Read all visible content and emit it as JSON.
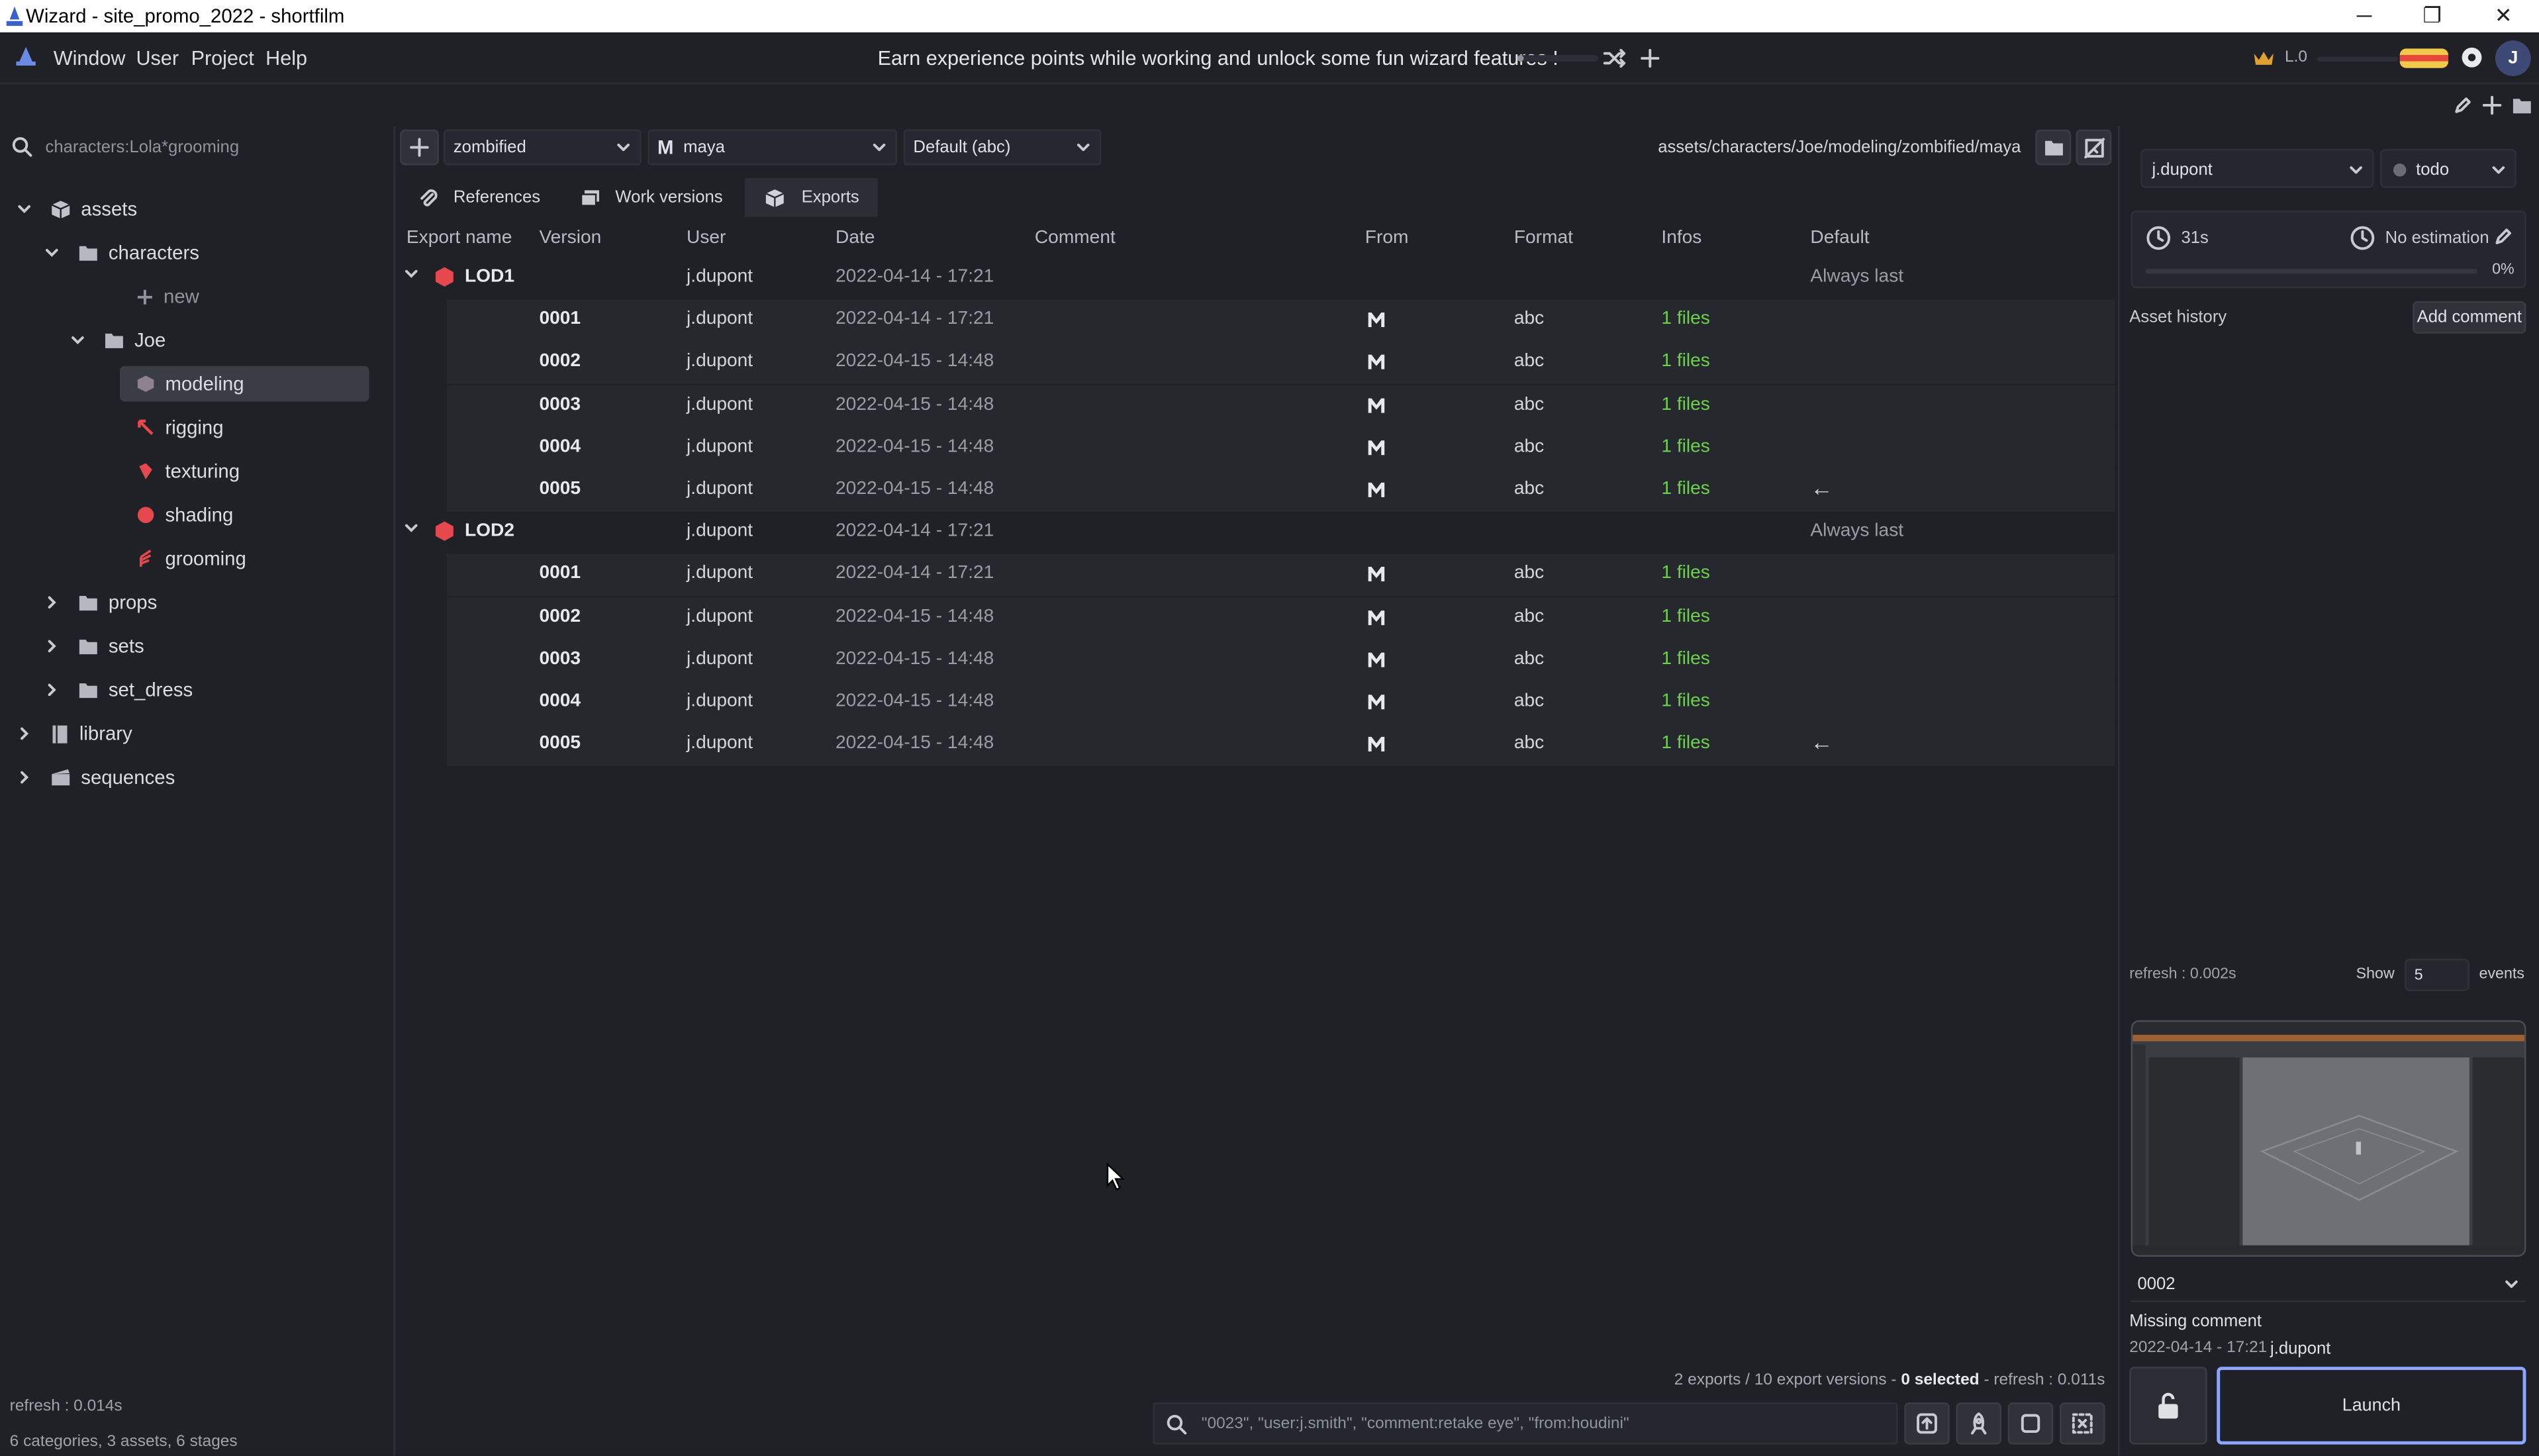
{
  "window": {
    "title": "Wizard - site_promo_2022 - shortfilm",
    "min": "─",
    "max": "❐",
    "close": "✕"
  },
  "menu": {
    "items": [
      "Window",
      "User",
      "Project",
      "Help"
    ]
  },
  "xp": {
    "message": "Earn experience points while working and unlock some fun wizard features !",
    "level": "L.0",
    "avatar_letter": "J"
  },
  "left": {
    "search_placeholder": "characters:Lola*grooming",
    "tree": [
      {
        "label": "assets",
        "depth": 0,
        "icon": "cube-icon",
        "expanded": true
      },
      {
        "label": "characters",
        "depth": 1,
        "icon": "folder-icon",
        "expanded": true
      },
      {
        "label": "new",
        "depth": 3,
        "icon": "plus-icon"
      },
      {
        "label": "Joe",
        "depth": 2,
        "icon": "folder-icon",
        "expanded": true
      },
      {
        "label": "modeling",
        "depth": 3,
        "icon": "modeling-icon",
        "selected": true
      },
      {
        "label": "rigging",
        "depth": 3,
        "icon": "rigging-icon"
      },
      {
        "label": "texturing",
        "depth": 3,
        "icon": "texturing-icon"
      },
      {
        "label": "shading",
        "depth": 3,
        "icon": "shading-icon"
      },
      {
        "label": "grooming",
        "depth": 3,
        "icon": "grooming-icon"
      },
      {
        "label": "props",
        "depth": 1,
        "icon": "folder-icon",
        "expanded": false
      },
      {
        "label": "sets",
        "depth": 1,
        "icon": "folder-icon",
        "expanded": false
      },
      {
        "label": "set_dress",
        "depth": 1,
        "icon": "folder-icon",
        "expanded": false
      },
      {
        "label": "library",
        "depth": 0,
        "icon": "book-icon",
        "expanded": false
      },
      {
        "label": "sequences",
        "depth": 0,
        "icon": "film-icon",
        "expanded": false
      }
    ],
    "refresh": "refresh : 0.014s",
    "summary": "6 categories, 3 assets, 6 stages"
  },
  "toolbar": {
    "variant": "zombified",
    "software": "maya",
    "software_letter": "M",
    "export_type": "Default (abc)",
    "path": "assets/characters/Joe/modeling/zombified/maya"
  },
  "tabs": [
    {
      "label": "References",
      "icon": "paperclip-icon"
    },
    {
      "label": "Work versions",
      "icon": "stack-icon"
    },
    {
      "label": "Exports",
      "icon": "box-icon",
      "active": true
    }
  ],
  "columns": [
    "Export name",
    "Version",
    "User",
    "Date",
    "Comment",
    "From",
    "Format",
    "Infos",
    "Default"
  ],
  "exports": [
    {
      "name": "LOD1",
      "user": "j.dupont",
      "date": "2022-04-14 - 17:21",
      "default": "Always last",
      "versions": [
        {
          "version": "0001",
          "user": "j.dupont",
          "date": "2022-04-14 - 17:21",
          "from": "M",
          "format": "abc",
          "infos": "1 files",
          "default": ""
        },
        {
          "version": "0002",
          "user": "j.dupont",
          "date": "2022-04-15 - 14:48",
          "from": "M",
          "format": "abc",
          "infos": "1 files",
          "default": ""
        },
        {
          "version": "0003",
          "user": "j.dupont",
          "date": "2022-04-15 - 14:48",
          "from": "M",
          "format": "abc",
          "infos": "1 files",
          "default": ""
        },
        {
          "version": "0004",
          "user": "j.dupont",
          "date": "2022-04-15 - 14:48",
          "from": "M",
          "format": "abc",
          "infos": "1 files",
          "default": ""
        },
        {
          "version": "0005",
          "user": "j.dupont",
          "date": "2022-04-15 - 14:48",
          "from": "M",
          "format": "abc",
          "infos": "1 files",
          "default": "←"
        }
      ]
    },
    {
      "name": "LOD2",
      "user": "j.dupont",
      "date": "2022-04-14 - 17:21",
      "default": "Always last",
      "versions": [
        {
          "version": "0001",
          "user": "j.dupont",
          "date": "2022-04-14 - 17:21",
          "from": "M",
          "format": "abc",
          "infos": "1 files",
          "default": ""
        },
        {
          "version": "0002",
          "user": "j.dupont",
          "date": "2022-04-15 - 14:48",
          "from": "M",
          "format": "abc",
          "infos": "1 files",
          "default": ""
        },
        {
          "version": "0003",
          "user": "j.dupont",
          "date": "2022-04-15 - 14:48",
          "from": "M",
          "format": "abc",
          "infos": "1 files",
          "default": ""
        },
        {
          "version": "0004",
          "user": "j.dupont",
          "date": "2022-04-15 - 14:48",
          "from": "M",
          "format": "abc",
          "infos": "1 files",
          "default": ""
        },
        {
          "version": "0005",
          "user": "j.dupont",
          "date": "2022-04-15 - 14:48",
          "from": "M",
          "format": "abc",
          "infos": "1 files",
          "default": "←"
        }
      ]
    }
  ],
  "footer": {
    "status_prefix": "2 exports / 10 export versions - ",
    "selected": "0 selected",
    "status_suffix": " - refresh : 0.011s",
    "search_placeholder": "\"0023\", \"user:j.smith\", \"comment:retake eye\", \"from:houdini\""
  },
  "right": {
    "user": "j.dupont",
    "state": "todo",
    "time_spent": "31s",
    "estimation": "No estimation",
    "progress": "0%",
    "progress_value": 0,
    "history_label": "Asset history",
    "add_comment": "Add comment",
    "refresh": "refresh : 0.002s",
    "show_label": "Show",
    "show_count": "5",
    "events_label": "events",
    "version": "0002",
    "comment": "Missing comment",
    "version_date": "2022-04-14 - 17:21",
    "version_user": "j.dupont",
    "launch": "Launch"
  },
  "colors": {
    "accent": "#6fcf4f",
    "export_red": "#e5484d",
    "launch_border": "#8fa6ff",
    "bg": "#1f2126"
  }
}
